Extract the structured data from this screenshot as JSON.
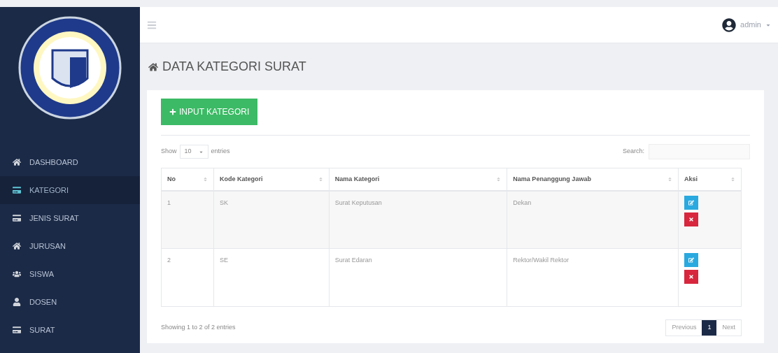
{
  "topbar": {
    "user": "admin"
  },
  "sidebar": {
    "items": [
      {
        "label": "DASHBOARD",
        "kind": "home",
        "selected": false
      },
      {
        "label": "KATEGORI",
        "kind": "card",
        "selected": true
      },
      {
        "label": "JENIS SURAT",
        "kind": "card",
        "selected": false
      },
      {
        "label": "JURUSAN",
        "kind": "home",
        "selected": false
      },
      {
        "label": "SISWA",
        "kind": "users",
        "selected": false
      },
      {
        "label": "DOSEN",
        "kind": "user",
        "selected": false
      },
      {
        "label": "SURAT",
        "kind": "card",
        "selected": false
      }
    ]
  },
  "page": {
    "title": "DATA KATEGORI SURAT",
    "add_button": "INPUT KATEGORI"
  },
  "table_controls": {
    "show_label": "Show",
    "page_size": "10",
    "entries_label": "entries",
    "search_label": "Search:"
  },
  "table": {
    "columns": [
      "No",
      "Kode Kategori",
      "Nama Kategori",
      "Nama Penanggung Jawab",
      "Aksi"
    ],
    "rows": [
      {
        "cells": [
          "1",
          "SK",
          "Surat Keputusan",
          "Dekan"
        ]
      },
      {
        "cells": [
          "2",
          "SE",
          "Surat Edaran",
          "Rektor/Wakil Rektor"
        ]
      }
    ]
  },
  "footer": {
    "info": "Showing 1 to 2 of 2 entries",
    "pages": [
      {
        "label": "Previous",
        "selected": false
      },
      {
        "label": "1",
        "selected": true
      },
      {
        "label": "Next",
        "selected": false
      }
    ]
  }
}
